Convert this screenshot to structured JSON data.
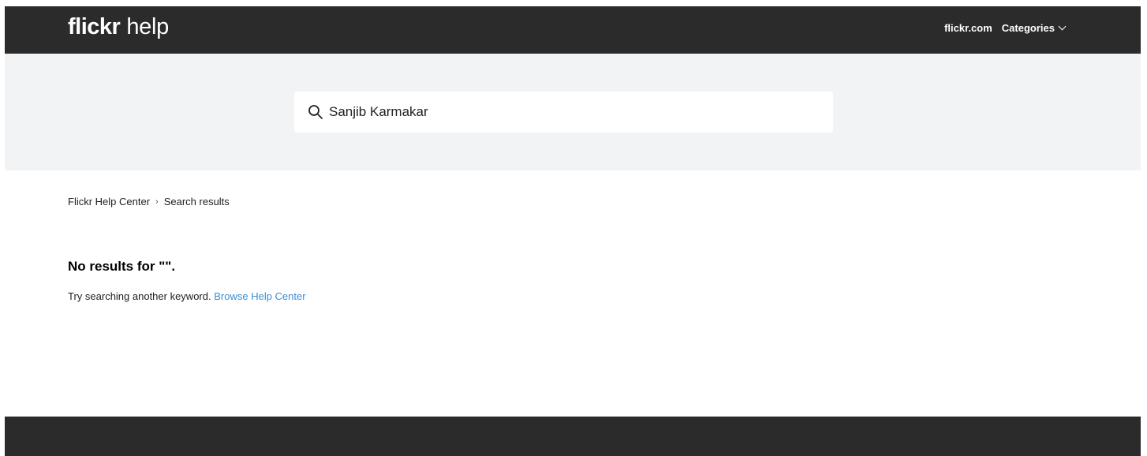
{
  "header": {
    "logo_primary": "flickr",
    "logo_secondary": "help",
    "nav_flickr": "flickr.com",
    "nav_categories": "Categories"
  },
  "search": {
    "value": "Sanjib Karmakar",
    "icon": "search-icon"
  },
  "breadcrumb": {
    "home": "Flickr Help Center",
    "separator": "›",
    "current": "Search results"
  },
  "results": {
    "heading": "No results for \"\".",
    "hint": "Try searching another keyword.",
    "browse_link": "Browse Help Center"
  },
  "colors": {
    "header_bg": "#2b2b2c",
    "search_band_bg": "#f2f3f4",
    "link": "#3b8fd6"
  }
}
